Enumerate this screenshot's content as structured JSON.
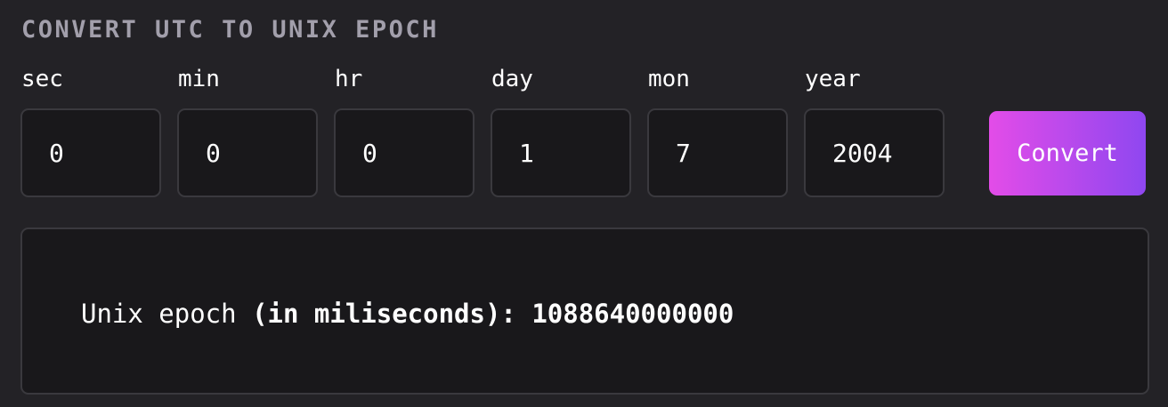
{
  "heading": "CONVERT UTC TO UNIX EPOCH",
  "fields": [
    {
      "label": "sec",
      "value": "0"
    },
    {
      "label": "min",
      "value": "0"
    },
    {
      "label": "hr",
      "value": "0"
    },
    {
      "label": "day",
      "value": "1"
    },
    {
      "label": "mon",
      "value": "7"
    },
    {
      "label": "year",
      "value": "2004"
    }
  ],
  "convert_button": "Convert",
  "result": {
    "prefix": "Unix epoch ",
    "unit": "(in miliseconds): ",
    "value": "1088640000000"
  },
  "colors": {
    "background": "#232226",
    "field_bg": "#19181b",
    "border": "#3a393e",
    "heading": "#a29fab",
    "button_gradient_start": "#e34ce8",
    "button_gradient_end": "#8f47f0"
  }
}
